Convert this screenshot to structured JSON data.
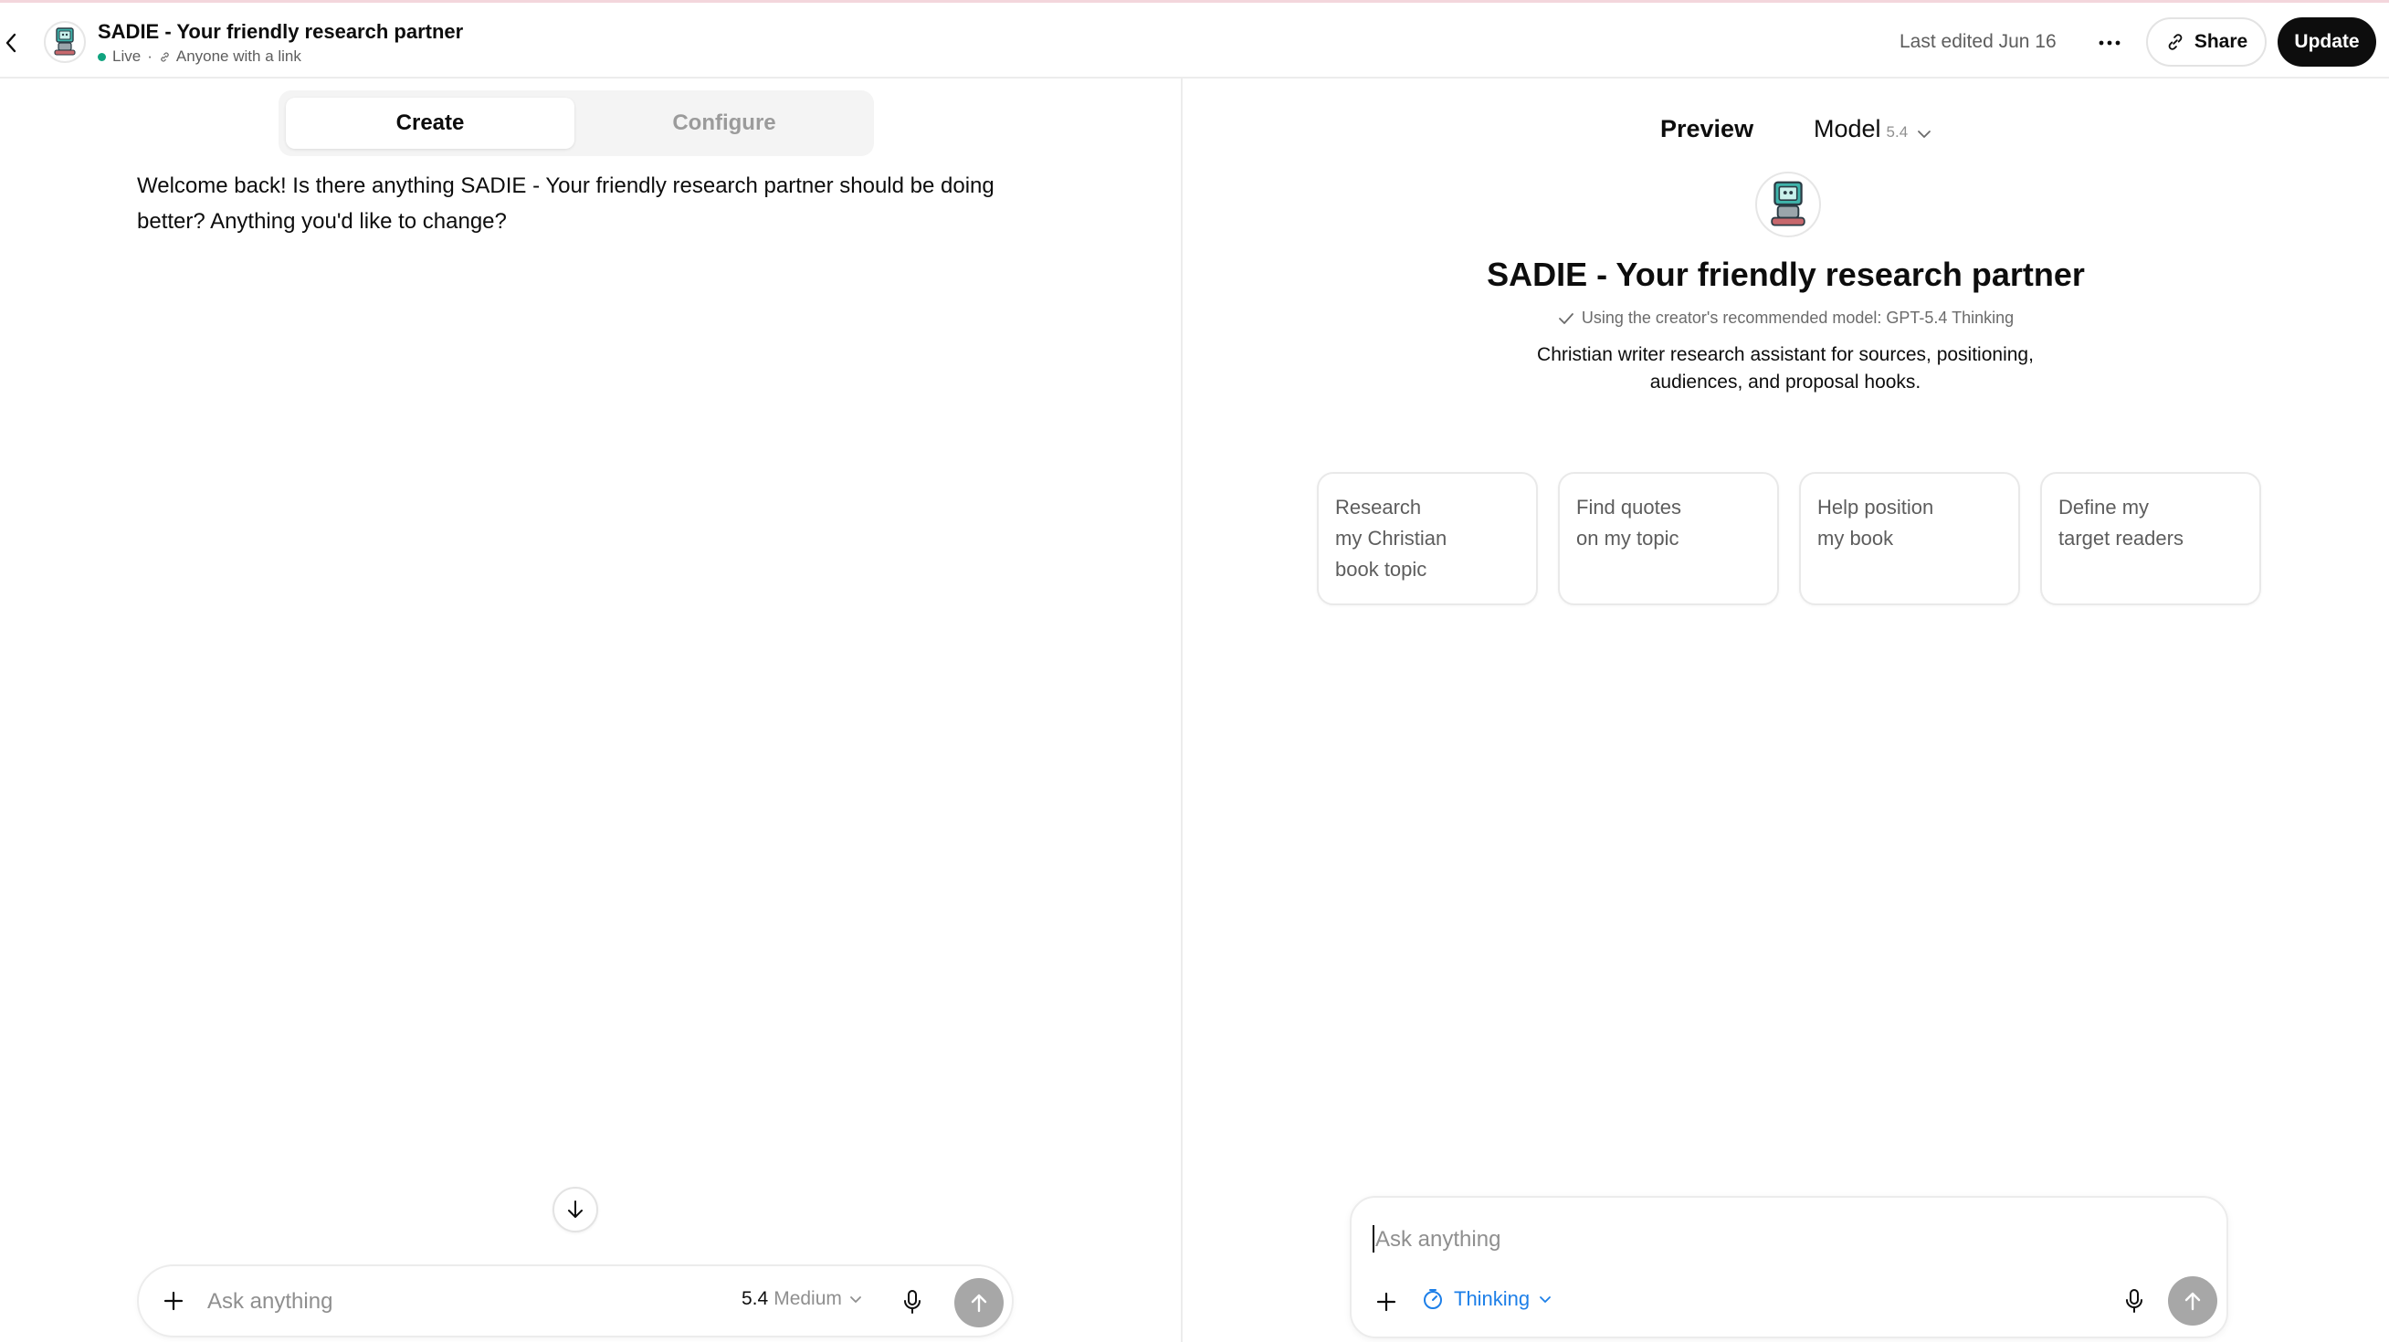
{
  "header": {
    "gpt_title": "SADIE - Your friendly research partner",
    "status_live": "Live",
    "status_separator": "·",
    "status_visibility": "Anyone with a link",
    "last_edited": "Last edited Jun 16",
    "share_label": "Share",
    "update_label": "Update",
    "icons": {
      "back": "chevron-left-icon",
      "more": "ellipsis-icon",
      "share": "link-icon"
    },
    "colors": {
      "live": "#10a37f",
      "update_bg": "#0d0d0d"
    }
  },
  "builder": {
    "tabs": [
      {
        "label": "Create",
        "selected": true
      },
      {
        "label": "Configure",
        "selected": false
      }
    ],
    "welcome_message": "Welcome back! Is there anything SADIE - Your friendly research partner should be doing better? Anything you'd like to change?",
    "composer": {
      "placeholder": "Ask anything",
      "model_version": "5.4",
      "model_effort": "Medium"
    }
  },
  "preview": {
    "label": "Preview",
    "model_label": "Model",
    "model_version": "5.4",
    "gpt_name": "SADIE - Your friendly research partner",
    "recommended_model": "Using the creator's recommended model: GPT-5.4 Thinking",
    "description": "Christian writer research assistant for sources, positioning, audiences, and proposal hooks.",
    "starters": [
      {
        "lines": [
          "Research",
          "my Christian",
          "book topic"
        ]
      },
      {
        "lines": [
          "Find quotes",
          "on my topic"
        ]
      },
      {
        "lines": [
          "Help position",
          "my book"
        ]
      },
      {
        "lines": [
          "Define my",
          "target readers"
        ]
      }
    ],
    "composer": {
      "placeholder": "Ask anything",
      "mode_label": "Thinking"
    },
    "colors": {
      "thinking": "#1d7fe8"
    }
  }
}
